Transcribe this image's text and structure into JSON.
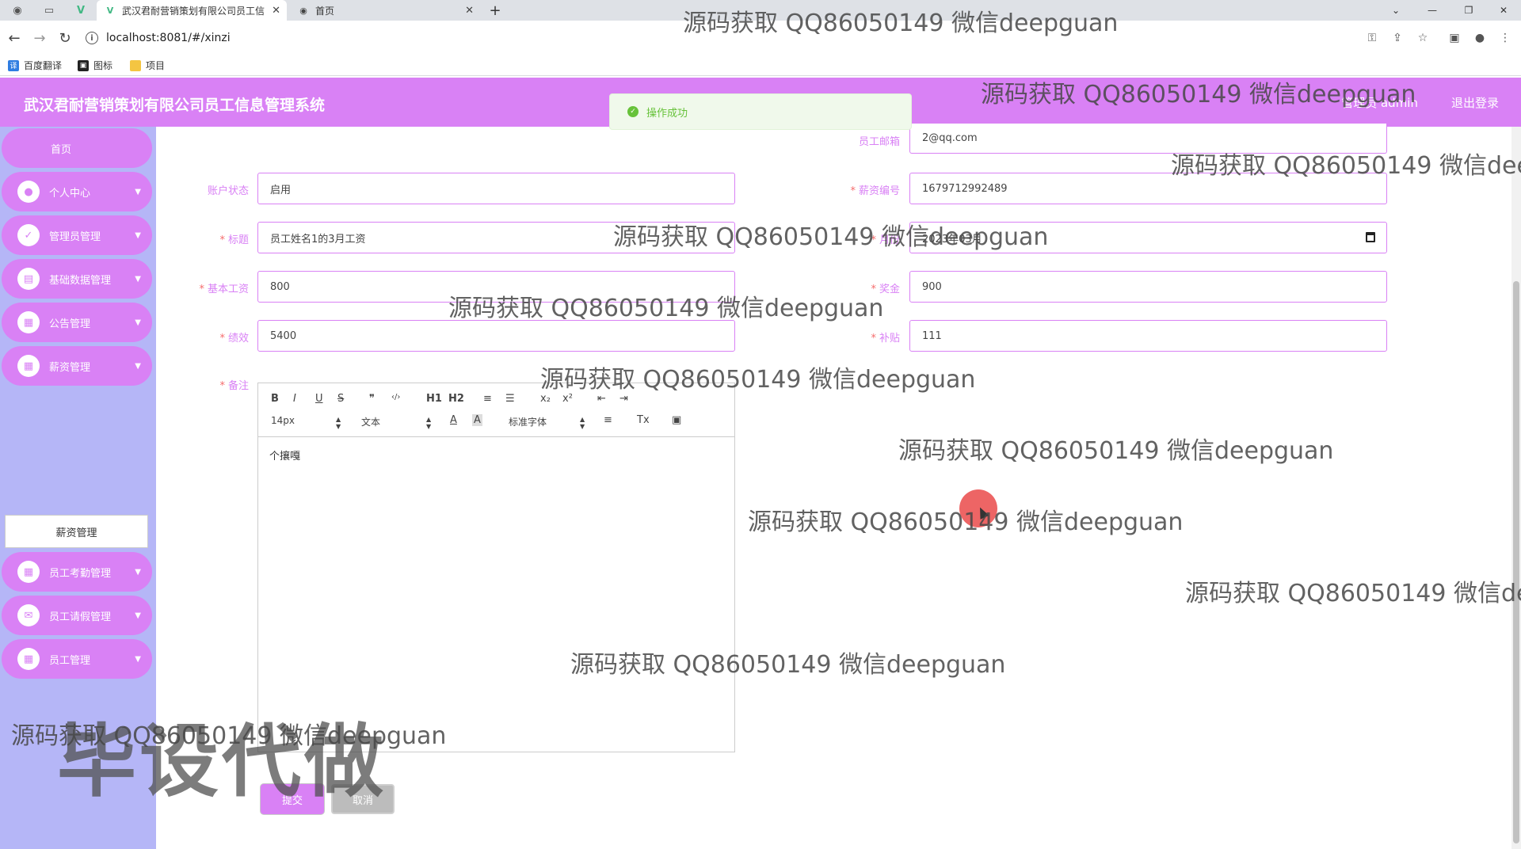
{
  "browser": {
    "tabs": [
      {
        "title": "武汉君耐营销策划有限公司员工信",
        "active": true
      },
      {
        "title": "首页",
        "active": false
      }
    ],
    "url": "localhost:8081/#/xinzi",
    "bookmarks": [
      "百度翻译",
      "图标",
      "项目"
    ]
  },
  "header": {
    "title": "武汉君耐营销策划有限公司员工信息管理系统",
    "admin": "管理员 admin",
    "logout": "退出登录"
  },
  "toast": {
    "message": "操作成功"
  },
  "sidebar": {
    "home": "首页",
    "items": [
      {
        "label": "个人中心",
        "icon": "user-icon"
      },
      {
        "label": "管理员管理",
        "icon": "admin-icon"
      },
      {
        "label": "基础数据管理",
        "icon": "data-icon"
      },
      {
        "label": "公告管理",
        "icon": "notice-icon"
      },
      {
        "label": "薪资管理",
        "icon": "salary-icon"
      },
      {
        "label": "员工考勤管理",
        "icon": "attendance-icon"
      },
      {
        "label": "员工请假管理",
        "icon": "leave-icon"
      },
      {
        "label": "员工管理",
        "icon": "employee-icon"
      }
    ],
    "active_sub": "薪资管理"
  },
  "form": {
    "email_label": "员工邮箱",
    "email_value": "2@qq.com",
    "status_label": "账户状态",
    "status_value": "启用",
    "salary_no_label": "薪资编号",
    "salary_no_value": "1679712992489",
    "title_label": "标题",
    "title_value": "员工姓名1的3月工资",
    "month_label": "月份",
    "month_value": "2023年03月",
    "base_label": "基本工资",
    "base_value": "800",
    "bonus_label": "奖金",
    "bonus_value": "900",
    "perf_label": "绩效",
    "perf_value": "5400",
    "allow_label": "补贴",
    "allow_value": "111",
    "remark_label": "备注",
    "remark_value": "个攘嘎",
    "required_mark": "*"
  },
  "editor": {
    "buttons": [
      "B",
      "I",
      "U",
      "S",
      "❞",
      "‹/›",
      "H1",
      "H2",
      "≡",
      "☰",
      "x₂",
      "x²",
      "⇤",
      "⇥",
      "A",
      "A",
      "≡",
      "Tx",
      "▣"
    ],
    "size": "14px",
    "header": "文本",
    "font": "标准字体"
  },
  "actions": {
    "submit": "提交",
    "cancel": "取消"
  },
  "watermarks": {
    "text": "源码获取 QQ86050149 微信deepguan",
    "big": "毕设代做"
  }
}
